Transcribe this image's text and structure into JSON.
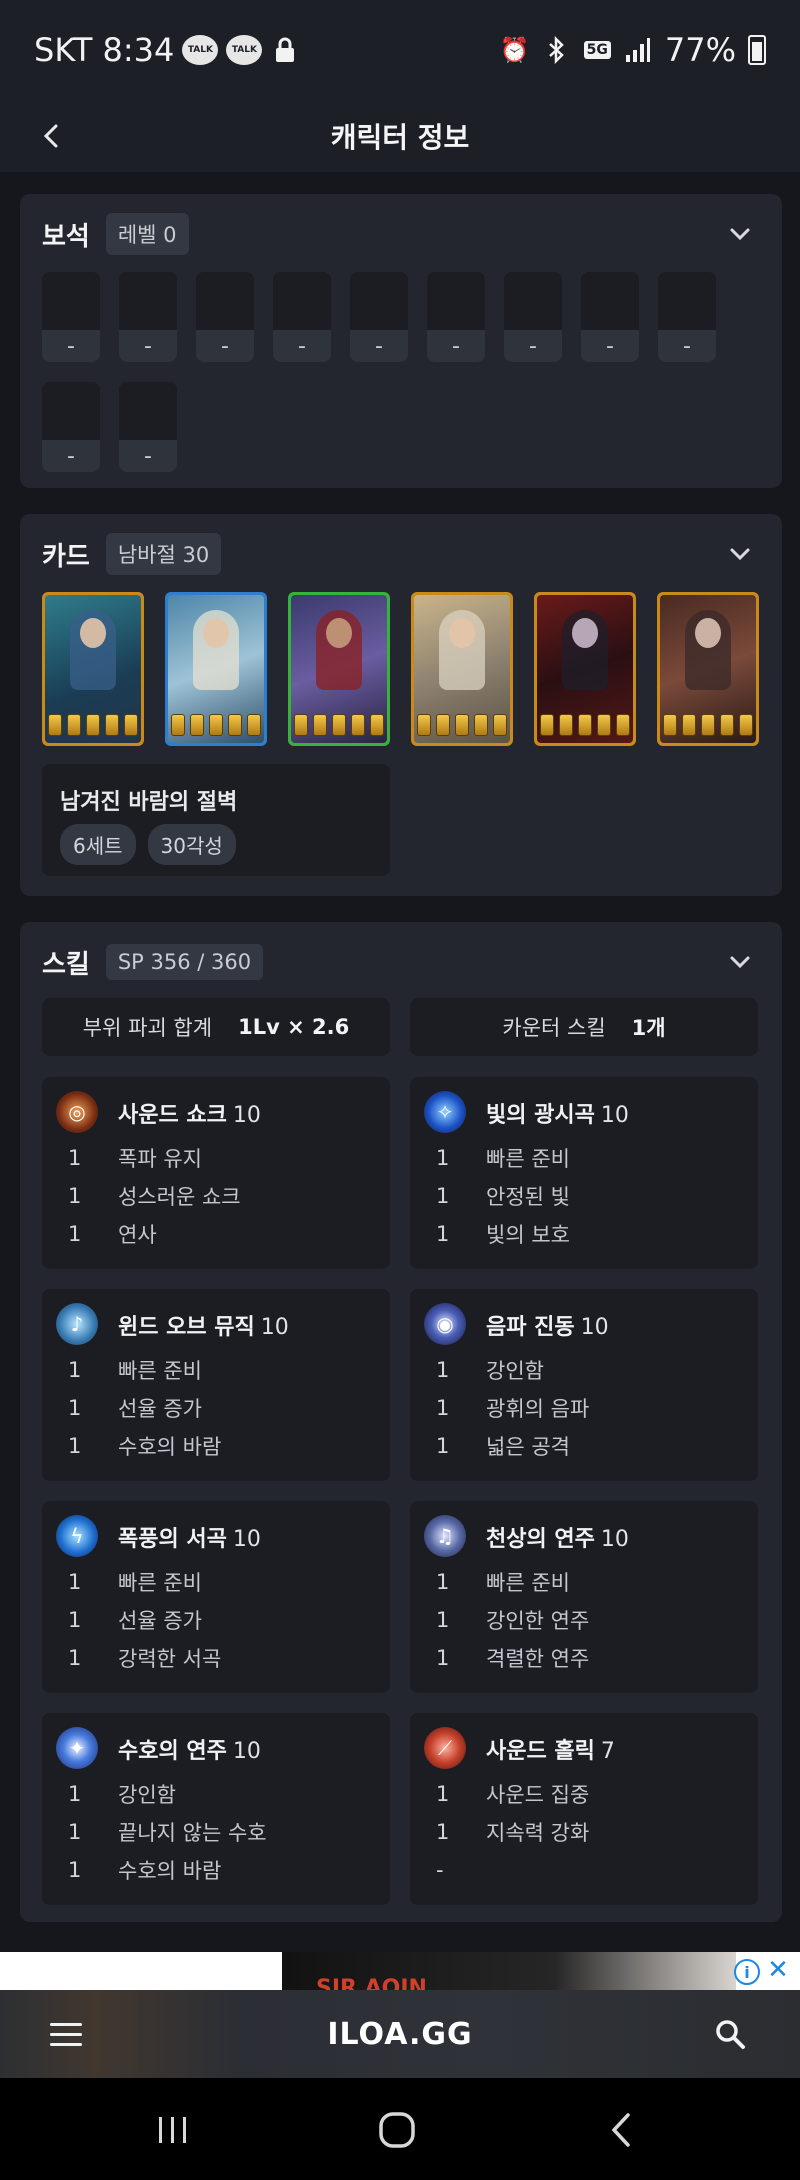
{
  "status_bar": {
    "carrier_time": "SKT 8:34",
    "notif_1": "TALK",
    "notif_2": "TALK",
    "network": "5G",
    "battery": "77%"
  },
  "header": {
    "title": "캐릭터 정보"
  },
  "gems": {
    "title": "보석",
    "level_pill": "레벨 0",
    "slots": [
      "-",
      "-",
      "-",
      "-",
      "-",
      "-",
      "-",
      "-",
      "-",
      "-",
      "-"
    ]
  },
  "cards": {
    "title": "카드",
    "set_pill": "남바절 30",
    "card_count": 6,
    "awakening_per_card": 5,
    "set_name": "남겨진 바람의 절벽",
    "tags": [
      "6세트",
      "30각성"
    ]
  },
  "skills": {
    "title": "스킬",
    "sp_pill": "SP 356 / 360",
    "stats": [
      {
        "label": "부위 파괴 합계",
        "value": "1Lv × 2.6"
      },
      {
        "label": "카운터 스킬",
        "value": "1개"
      }
    ],
    "list": [
      {
        "name": "사운드 쇼크",
        "level": "10",
        "icon": "sound-shock-icon",
        "tripods": [
          {
            "n": "1",
            "t": "폭파 유지"
          },
          {
            "n": "1",
            "t": "성스러운 쇼크"
          },
          {
            "n": "1",
            "t": "연사"
          }
        ]
      },
      {
        "name": "빛의 광시곡",
        "level": "10",
        "icon": "rhapsody-of-light-icon",
        "tripods": [
          {
            "n": "1",
            "t": "빠른 준비"
          },
          {
            "n": "1",
            "t": "안정된 빛"
          },
          {
            "n": "1",
            "t": "빛의 보호"
          }
        ]
      },
      {
        "name": "윈드 오브 뮤직",
        "level": "10",
        "icon": "wind-of-music-icon",
        "tripods": [
          {
            "n": "1",
            "t": "빠른 준비"
          },
          {
            "n": "1",
            "t": "선율 증가"
          },
          {
            "n": "1",
            "t": "수호의 바람"
          }
        ]
      },
      {
        "name": "음파 진동",
        "level": "10",
        "icon": "sonic-vibration-icon",
        "tripods": [
          {
            "n": "1",
            "t": "강인함"
          },
          {
            "n": "1",
            "t": "광휘의 음파"
          },
          {
            "n": "1",
            "t": "넓은 공격"
          }
        ]
      },
      {
        "name": "폭풍의 서곡",
        "level": "10",
        "icon": "prelude-of-storm-icon",
        "tripods": [
          {
            "n": "1",
            "t": "빠른 준비"
          },
          {
            "n": "1",
            "t": "선율 증가"
          },
          {
            "n": "1",
            "t": "강력한 서곡"
          }
        ]
      },
      {
        "name": "천상의 연주",
        "level": "10",
        "icon": "heavenly-tune-icon",
        "tripods": [
          {
            "n": "1",
            "t": "빠른 준비"
          },
          {
            "n": "1",
            "t": "강인한 연주"
          },
          {
            "n": "1",
            "t": "격렬한 연주"
          }
        ]
      },
      {
        "name": "수호의 연주",
        "level": "10",
        "icon": "guardian-tune-icon",
        "tripods": [
          {
            "n": "1",
            "t": "강인함"
          },
          {
            "n": "1",
            "t": "끝나지 않는 수호"
          },
          {
            "n": "1",
            "t": "수호의 바람"
          }
        ]
      },
      {
        "name": "사운드 홀릭",
        "level": "7",
        "icon": "sound-holic-icon",
        "tripods": [
          {
            "n": "1",
            "t": "사운드 집중"
          },
          {
            "n": "1",
            "t": "지속력 강화"
          },
          {
            "n": "-",
            "t": ""
          }
        ]
      }
    ]
  },
  "ad": {
    "creative_text": "SIR AQIN"
  },
  "bottom_nav": {
    "logo": "ILOA.GG"
  }
}
